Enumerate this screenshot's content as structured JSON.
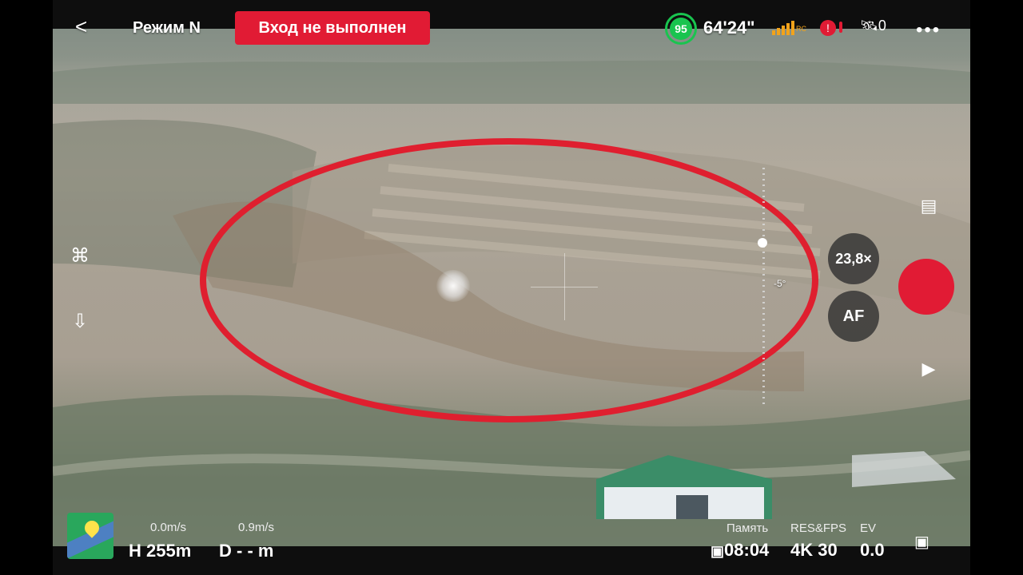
{
  "top_bar": {
    "back_label": "<",
    "mode_label": "Режим N",
    "warning_label": "Вход не выполнен",
    "battery_percent": "95",
    "flight_time": "64'24\"",
    "signal_label": "RC",
    "alert_icon": "!",
    "satellite_count": "0",
    "more_label": "•••"
  },
  "camera": {
    "zoom_label": "23,8×",
    "af_label": "AF",
    "gimbal_angle": "-5°"
  },
  "telemetry": {
    "horizontal_speed": "0.0m/s",
    "vertical_speed": "0.9m/s",
    "height_label": "H 255m",
    "distance_label": "D - - m"
  },
  "recording": {
    "memory_label": "Память",
    "res_fps_label": "RES&FPS",
    "ev_label": "EV",
    "time_value": "08:04",
    "res_value": "4K 30",
    "ev_value": "0.0"
  },
  "colors": {
    "accent_red": "#e11b34",
    "battery_green": "#19c44f",
    "dark_bar": "#0e0e0e"
  },
  "icons": {
    "left_top": "map-toggle-icon",
    "left_bottom": "return-home-icon",
    "right_top": "camera-settings-icon",
    "right_bottom": "playback-icon",
    "bottom_right": "lens-icon"
  }
}
